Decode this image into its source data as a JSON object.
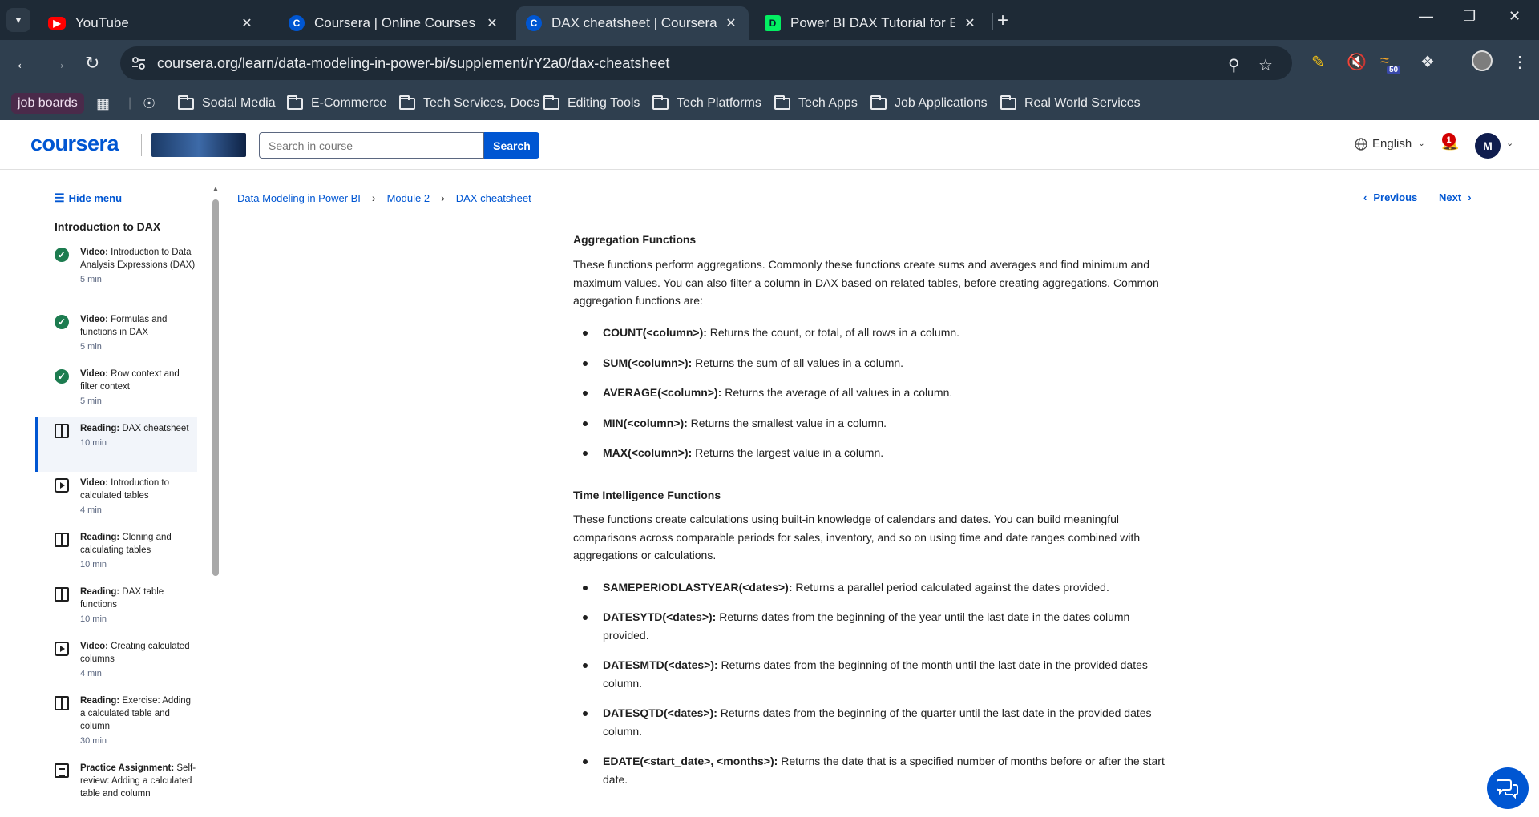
{
  "browser": {
    "tabs": [
      {
        "title": "YouTube",
        "favicon": "youtube-icon",
        "color": "#ff0000"
      },
      {
        "title": "Coursera | Online Courses From Top Universities",
        "favicon": "coursera-icon",
        "color": "#0056d2"
      },
      {
        "title": "DAX cheatsheet | Coursera",
        "favicon": "coursera-icon",
        "color": "#0056d2",
        "active": true
      },
      {
        "title": "Power BI DAX Tutorial for Beginners",
        "favicon": "datacamp-icon",
        "color": "#03ef62"
      }
    ],
    "url": "coursera.org/learn/data-modeling-in-power-bi/supplement/rY2a0/dax-cheatsheet",
    "extension_badge": "50",
    "bookmarks": {
      "pinned": "job boards",
      "folders": [
        "Social Media",
        "E-Commerce",
        "Tech Services, Docs",
        "Editing Tools",
        "Tech Platforms",
        "Tech Apps",
        "Job Applications",
        "Real World Services"
      ]
    }
  },
  "header": {
    "logo": "coursera",
    "search_placeholder": "Search in course",
    "search_button": "Search",
    "language": "English",
    "notification_count": "1",
    "avatar_initial": "M"
  },
  "sidebar": {
    "hide_menu": "Hide menu",
    "module_title": "Introduction to DAX",
    "items": [
      {
        "kind": "Video:",
        "title": "Introduction to Data Analysis Expressions (DAX)",
        "duration": "5 min",
        "status": "completed",
        "icon": "check-circle-icon"
      },
      {
        "kind": "Video:",
        "title": "Formulas and functions in DAX",
        "duration": "5 min",
        "status": "completed",
        "icon": "check-circle-icon"
      },
      {
        "kind": "Video:",
        "title": "Row context and filter context",
        "duration": "5 min",
        "status": "completed",
        "icon": "check-circle-icon"
      },
      {
        "kind": "Reading:",
        "title": "DAX cheatsheet",
        "duration": "10 min",
        "status": "current",
        "icon": "book-icon"
      },
      {
        "kind": "Video:",
        "title": "Introduction to calculated tables",
        "duration": "4 min",
        "status": "todo",
        "icon": "play-icon"
      },
      {
        "kind": "Reading:",
        "title": "Cloning and calculating tables",
        "duration": "10 min",
        "status": "todo",
        "icon": "book-icon"
      },
      {
        "kind": "Reading:",
        "title": "DAX table functions",
        "duration": "10 min",
        "status": "todo",
        "icon": "book-icon"
      },
      {
        "kind": "Video:",
        "title": "Creating calculated columns",
        "duration": "4 min",
        "status": "todo",
        "icon": "play-icon"
      },
      {
        "kind": "Reading:",
        "title": "Exercise: Adding a calculated table and column",
        "duration": "30 min",
        "status": "todo",
        "icon": "book-icon"
      },
      {
        "kind": "Practice Assignment:",
        "title": "Self-review: Adding a calculated table and column",
        "duration": "",
        "status": "todo",
        "icon": "assignment-icon"
      }
    ]
  },
  "breadcrumb": [
    "Data Modeling in Power BI",
    "Module 2",
    "DAX cheatsheet"
  ],
  "pager": {
    "previous": "Previous",
    "next": "Next"
  },
  "article": {
    "sections": [
      {
        "heading": "Aggregation Functions",
        "intro": "These functions perform aggregations. Commonly these functions create sums and averages and find minimum and maximum values. You can also filter a column in DAX based on related tables, before creating aggregations. Common aggregation functions are:",
        "items": [
          {
            "fn": "COUNT(<column>):",
            "desc": " Returns the count, or total, of all rows in a column."
          },
          {
            "fn": "SUM(<column>):",
            "desc": " Returns the sum of all values in a column."
          },
          {
            "fn": "AVERAGE(<column>):",
            "desc": " Returns the average of all values in a column."
          },
          {
            "fn": "MIN(<column>):",
            "desc": " Returns the smallest value in a column."
          },
          {
            "fn": "MAX(<column>):",
            "desc": " Returns the largest value in a column."
          }
        ]
      },
      {
        "heading": "Time Intelligence Functions",
        "intro": "These functions create calculations using built-in knowledge of calendars and dates. You can build meaningful comparisons across comparable periods for sales, inventory, and so on using time and date ranges combined with aggregations or calculations.",
        "items": [
          {
            "fn": "SAMEPERIODLASTYEAR(<dates>):",
            "desc": " Returns a parallel period calculated against the dates provided."
          },
          {
            "fn": "DATESYTD(<dates>):",
            "desc": " Returns dates from the beginning of the year until the last date in the dates column provided."
          },
          {
            "fn": "DATESMTD(<dates>):",
            "desc": " Returns dates from the beginning of the month until the last date in the provided dates column."
          },
          {
            "fn": "DATESQTD(<dates>):",
            "desc": " Returns dates from the beginning of the quarter until the last date in the provided dates column."
          },
          {
            "fn": "EDATE(<start_date>, <months>):",
            "desc": " Returns the date that is a specified number of months before or after the start date."
          }
        ]
      }
    ]
  },
  "colors": {
    "accent": "#0056d2",
    "complete": "#1d7c50",
    "chrome_dark": "#1e2a36",
    "chrome": "#2f3f4f"
  }
}
